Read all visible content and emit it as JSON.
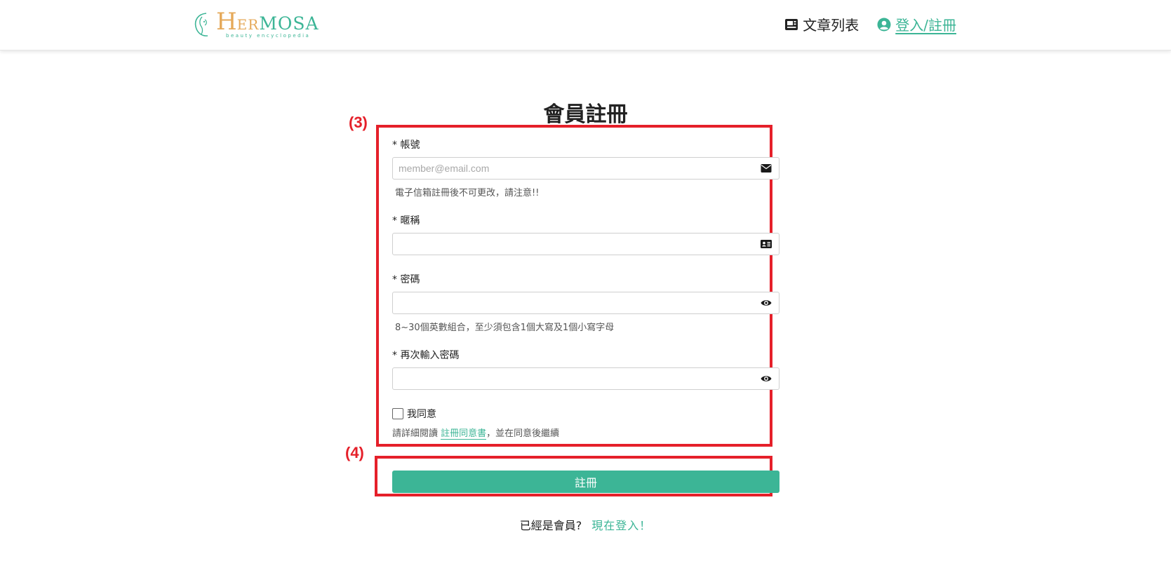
{
  "header": {
    "logo": {
      "brand_h": "H",
      "brand_er": "ER",
      "brand_mosa": "MOSA",
      "brand_sub": "beauty encyclopedia"
    },
    "nav": {
      "articles_label": "文章列表",
      "login_label": "登入/註冊"
    }
  },
  "page": {
    "title": "會員註冊"
  },
  "annotations": {
    "form_label": "(3)",
    "submit_label": "(4)",
    "color": "#e5202a"
  },
  "form": {
    "account": {
      "label": "* 帳號",
      "placeholder": "member@email.com",
      "value": "",
      "hint": "電子信箱註冊後不可更改，請注意!!",
      "icon": "envelope-icon"
    },
    "nickname": {
      "label": "* 暱稱",
      "value": "",
      "icon": "id-card-icon"
    },
    "password": {
      "label": "* 密碼",
      "value": "",
      "hint": "8~30個英數組合，至少須包含1個大寫及1個小寫字母",
      "icon": "eye-icon"
    },
    "password_confirm": {
      "label": "* 再次輸入密碼",
      "value": "",
      "icon": "eye-icon"
    },
    "agree": {
      "label": "我同意",
      "checked": false,
      "note_prefix": "請詳細閱讀",
      "note_link": "註冊同意書",
      "note_suffix": "，並在同意後繼續"
    },
    "submit_label": "註冊"
  },
  "footer": {
    "question": "已經是會員?",
    "login_now": "現在登入！"
  },
  "colors": {
    "accent": "#3cb596",
    "logo_gold": "#e5a95a"
  }
}
